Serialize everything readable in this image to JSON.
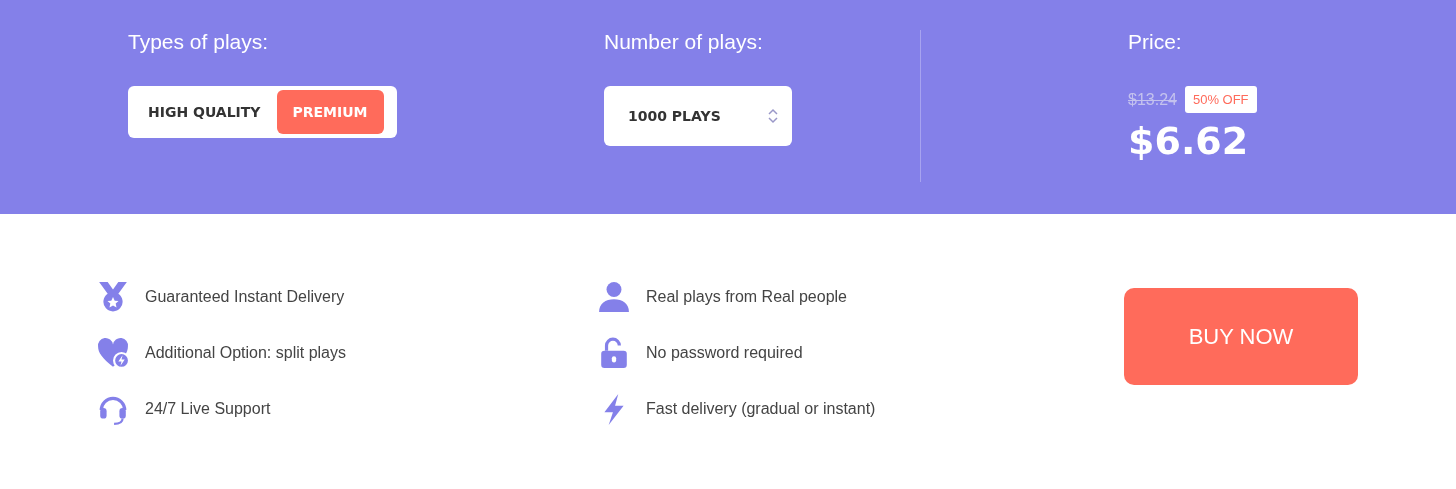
{
  "types": {
    "label": "Types of plays:",
    "options": [
      {
        "label": "HIGH QUALITY",
        "selected": false
      },
      {
        "label": "PREMIUM",
        "selected": true
      }
    ]
  },
  "number": {
    "label": "Number of plays:",
    "value": "1000 PLAYS"
  },
  "price": {
    "label": "Price:",
    "old": "$13.24",
    "discount": "50% OFF",
    "current": "$6.62"
  },
  "features": [
    {
      "text": "Guaranteed Instant Delivery"
    },
    {
      "text": "Additional Option: split plays"
    },
    {
      "text": "24/7 Live Support"
    },
    {
      "text": "Real plays from Real people"
    },
    {
      "text": "No password required"
    },
    {
      "text": "Fast delivery (gradual or instant)"
    }
  ],
  "buy_button": "BUY NOW"
}
